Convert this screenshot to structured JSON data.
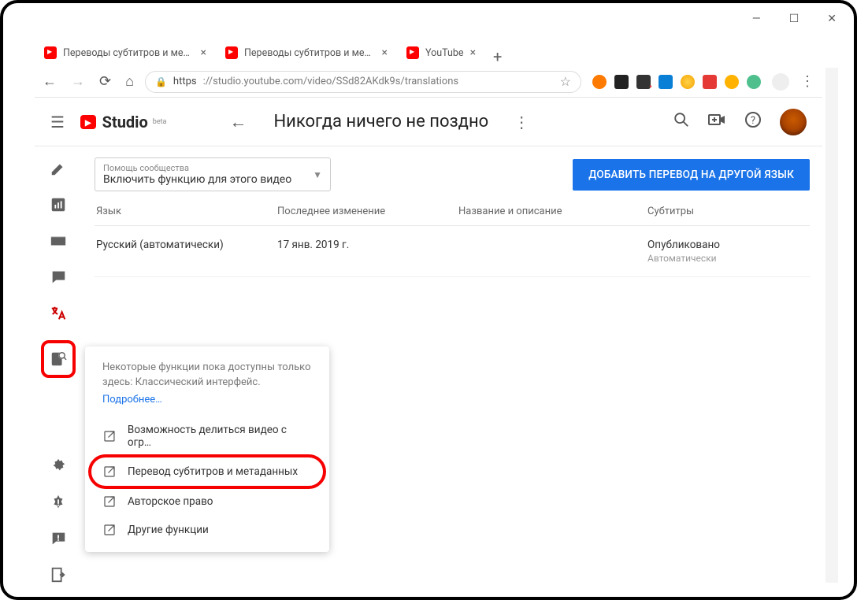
{
  "browser": {
    "tabs": [
      {
        "title": "Переводы субтитров и метадан"
      },
      {
        "title": "Переводы субтитров и метадан"
      },
      {
        "title": "YouTube"
      }
    ],
    "url_secure": "https",
    "url_rest": "://studio.youtube.com/video/SSd82AKdk9s/translations"
  },
  "studio": {
    "logo_text": "Studio",
    "logo_sup": "beta",
    "video_title": "Никогда ничего не поздно"
  },
  "community_help": {
    "label": "Помощь сообщества",
    "value": "Включить функцию для этого видео"
  },
  "add_button": "ДОБАВИТЬ ПЕРЕВОД НА ДРУГОЙ ЯЗЫК",
  "table": {
    "headers": {
      "lang": "Язык",
      "modified": "Последнее изменение",
      "titledesc": "Название и описание",
      "subs": "Субтитры"
    },
    "rows": [
      {
        "lang": "Русский (автоматически)",
        "modified": "17 янв. 2019 г.",
        "titledesc": "",
        "subs": "Опубликовано",
        "subs2": "Автоматически"
      }
    ]
  },
  "popup": {
    "note": "Некоторые функции пока доступны только здесь: Классический интерфейс.",
    "more": "Подробнее…",
    "items": [
      "Возможность делиться видео с огр…",
      "Перевод субтитров и метаданных",
      "Авторское право",
      "Другие функции"
    ]
  }
}
